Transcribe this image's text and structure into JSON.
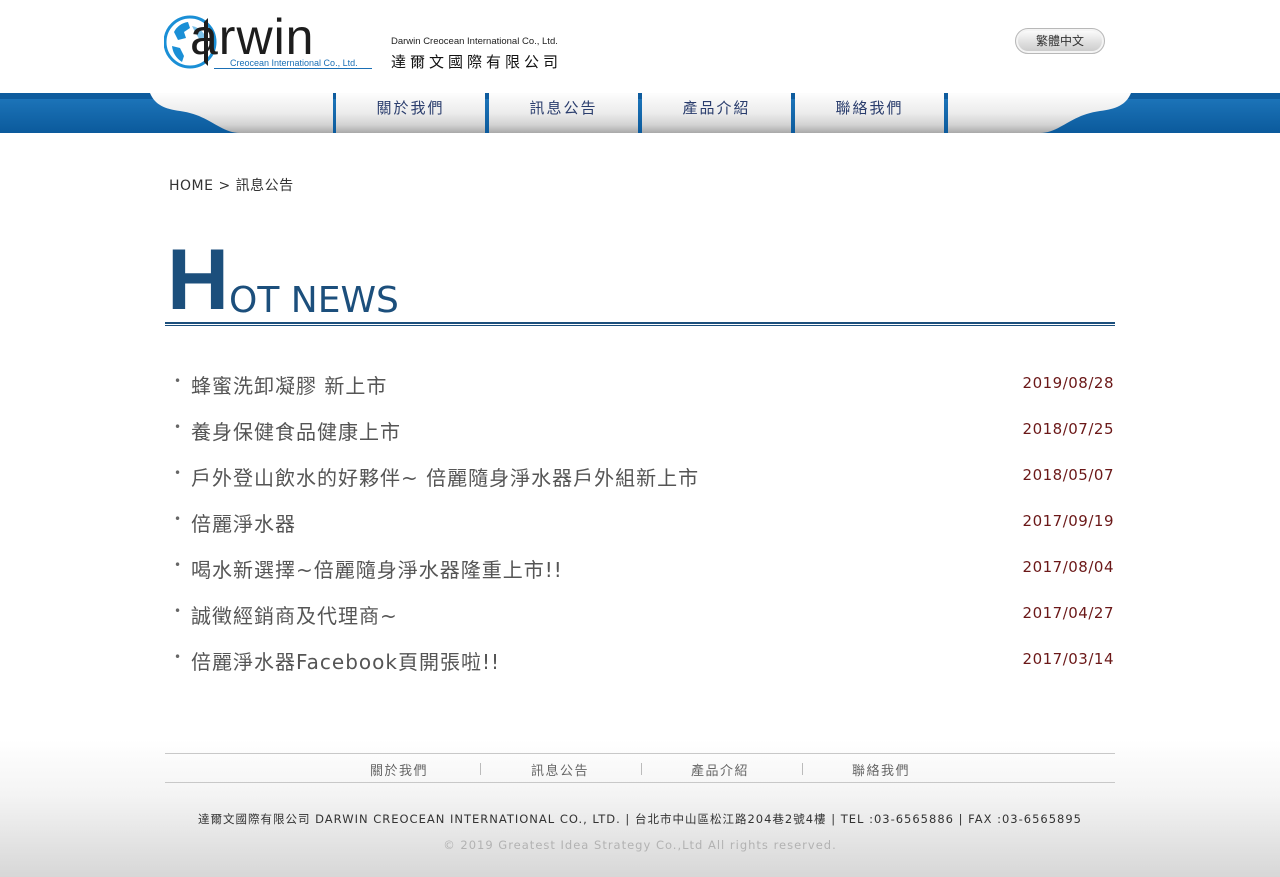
{
  "brand": {
    "logo_text": "arwin",
    "logo_sub": "Creocean International Co., Ltd.",
    "company_en": "Darwin Creocean International Co., Ltd.",
    "company_zh": "達爾文國際有限公司",
    "primary_color": "#1a6fb5",
    "title_color": "#1c4f7c"
  },
  "header": {
    "language_label": "繁體中文"
  },
  "nav": {
    "items": [
      {
        "label": "關於我們"
      },
      {
        "label": "訊息公告"
      },
      {
        "label": "產品介紹"
      },
      {
        "label": "聯絡我們"
      }
    ]
  },
  "breadcrumb": {
    "home": "HOME",
    "separator": ">",
    "current": "訊息公告"
  },
  "section": {
    "title_initial": "H",
    "title_rest": "OT NEWS"
  },
  "news": {
    "bullet": "•",
    "items": [
      {
        "title": "蜂蜜洗卸凝膠 新上市",
        "date": "2019/08/28"
      },
      {
        "title": "養身保健食品健康上市",
        "date": "2018/07/25"
      },
      {
        "title": "戶外登山飲水的好夥伴~ 倍麗隨身淨水器戶外組新上市",
        "date": "2018/05/07"
      },
      {
        "title": "倍麗淨水器",
        "date": "2017/09/19"
      },
      {
        "title": "喝水新選擇~倍麗隨身淨水器隆重上市!!",
        "date": "2017/08/04"
      },
      {
        "title": "誠徵經銷商及代理商~",
        "date": "2017/04/27"
      },
      {
        "title": "倍麗淨水器Facebook頁開張啦!!",
        "date": "2017/03/14"
      }
    ]
  },
  "footer": {
    "nav": [
      {
        "label": "關於我們"
      },
      {
        "label": "訊息公告"
      },
      {
        "label": "產品介紹"
      },
      {
        "label": "聯絡我們"
      }
    ],
    "info": "達爾文國際有限公司 DARWIN CREOCEAN INTERNATIONAL CO., LTD. | 台北市中山區松江路204巷2號4樓 | TEL :03-6565886 | FAX :03-6565895",
    "copyright": "© 2019 Greatest Idea Strategy Co.,Ltd All rights reserved."
  }
}
